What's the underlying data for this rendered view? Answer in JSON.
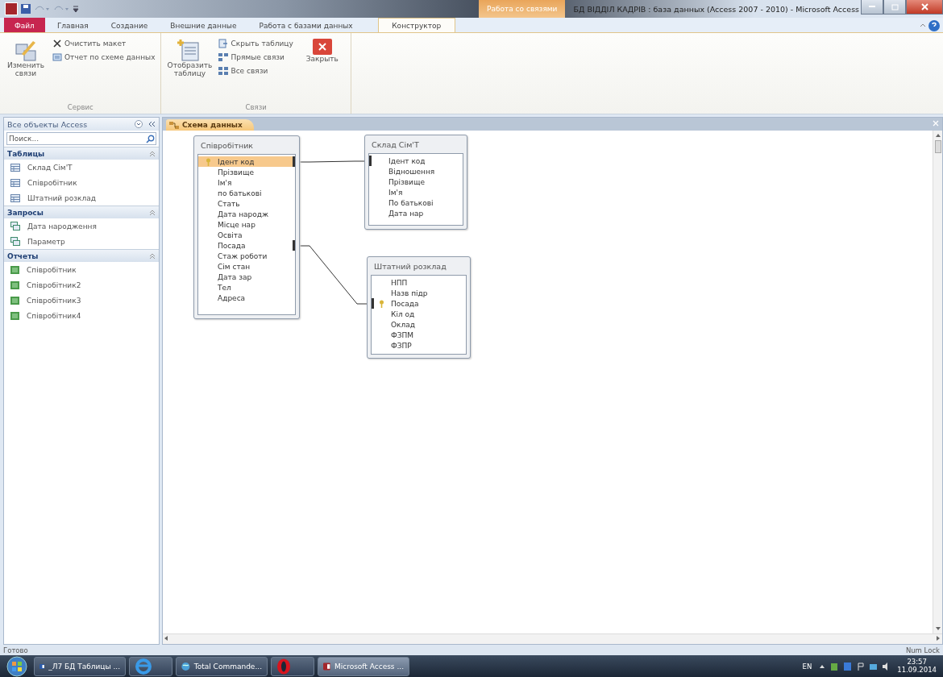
{
  "title_bar": {
    "context_group": "Работа со связями",
    "title": "БД ВІДДІЛ КАДРІВ : база данных (Access 2007 - 2010)  -  Microsoft Access"
  },
  "ribbon_tabs": [
    {
      "label": "Файл",
      "kind": "file",
      "selected": false
    },
    {
      "label": "Главная",
      "kind": "normal",
      "selected": false
    },
    {
      "label": "Создание",
      "kind": "normal",
      "selected": false
    },
    {
      "label": "Внешние данные",
      "kind": "normal",
      "selected": false
    },
    {
      "label": "Работа с базами данных",
      "kind": "normal",
      "selected": false
    },
    {
      "label": "Конструктор",
      "kind": "context",
      "selected": true
    }
  ],
  "ribbon_groups": [
    {
      "label": "Сервис",
      "buttons": [
        {
          "label": "Изменить связи",
          "kind": "large"
        },
        {
          "label": "Очистить макет",
          "kind": "small"
        },
        {
          "label": "Отчет по схеме данных",
          "kind": "small"
        }
      ]
    },
    {
      "label": "Связи",
      "buttons": [
        {
          "label": "Отобразить таблицу",
          "kind": "large"
        },
        {
          "label": "Скрыть таблицу",
          "kind": "small"
        },
        {
          "label": "Прямые связи",
          "kind": "small"
        },
        {
          "label": "Все связи",
          "kind": "small"
        },
        {
          "label": "Закрыть",
          "kind": "large"
        }
      ]
    }
  ],
  "nav_pane": {
    "title": "Все объекты Access",
    "search": {
      "placeholder": "Поиск..."
    },
    "sections": [
      {
        "title": "Таблицы",
        "items": [
          {
            "label": "Склад Сім'Т",
            "kind": "table"
          },
          {
            "label": "Співробітник",
            "kind": "table"
          },
          {
            "label": "Штатний розклад",
            "kind": "table"
          }
        ]
      },
      {
        "title": "Запросы",
        "items": [
          {
            "label": "Дата народження",
            "kind": "query"
          },
          {
            "label": "Параметр",
            "kind": "query"
          }
        ]
      },
      {
        "title": "Отчеты",
        "items": [
          {
            "label": "Співробітник",
            "kind": "report"
          },
          {
            "label": "Співробітник2",
            "kind": "report"
          },
          {
            "label": "Співробітник3",
            "kind": "report"
          },
          {
            "label": "Співробітник4",
            "kind": "report"
          }
        ]
      }
    ]
  },
  "document_tabs": [
    {
      "label": "Схема данных",
      "selected": true
    }
  ],
  "diagram": {
    "tables": [
      {
        "title": "Співробітник",
        "fields": [
          {
            "name": "Ідент код",
            "primary_key": true,
            "selected": true,
            "linked": true
          },
          {
            "name": "Прізвище",
            "primary_key": false,
            "selected": false,
            "linked": false
          },
          {
            "name": "Ім'я",
            "primary_key": false,
            "selected": false,
            "linked": false
          },
          {
            "name": "по батькові",
            "primary_key": false,
            "selected": false,
            "linked": false
          },
          {
            "name": "Стать",
            "primary_key": false,
            "selected": false,
            "linked": false
          },
          {
            "name": "Дата народж",
            "primary_key": false,
            "selected": false,
            "linked": false
          },
          {
            "name": "Місце нар",
            "primary_key": false,
            "selected": false,
            "linked": false
          },
          {
            "name": "Освіта",
            "primary_key": false,
            "selected": false,
            "linked": false
          },
          {
            "name": "Посада",
            "primary_key": false,
            "selected": false,
            "linked": true
          },
          {
            "name": "Стаж роботи",
            "primary_key": false,
            "selected": false,
            "linked": false
          },
          {
            "name": "Сім стан",
            "primary_key": false,
            "selected": false,
            "linked": false
          },
          {
            "name": "Дата зар",
            "primary_key": false,
            "selected": false,
            "linked": false
          },
          {
            "name": "Тел",
            "primary_key": false,
            "selected": false,
            "linked": false
          },
          {
            "name": "Адреса",
            "primary_key": false,
            "selected": false,
            "linked": false
          }
        ]
      },
      {
        "title": "Склад Сім'Т",
        "fields": [
          {
            "name": "Ідент код",
            "primary_key": false,
            "selected": false,
            "linked": true
          },
          {
            "name": "Відношення",
            "primary_key": false,
            "selected": false,
            "linked": false
          },
          {
            "name": "Прізвище",
            "primary_key": false,
            "selected": false,
            "linked": false
          },
          {
            "name": "Ім'я",
            "primary_key": false,
            "selected": false,
            "linked": false
          },
          {
            "name": "По батькові",
            "primary_key": false,
            "selected": false,
            "linked": false
          },
          {
            "name": "Дата нар",
            "primary_key": false,
            "selected": false,
            "linked": false
          }
        ]
      },
      {
        "title": "Штатний розклад",
        "fields": [
          {
            "name": "НПП",
            "primary_key": false,
            "selected": false,
            "linked": false
          },
          {
            "name": "Назв підр",
            "primary_key": false,
            "selected": false,
            "linked": false
          },
          {
            "name": "Посада",
            "primary_key": true,
            "selected": false,
            "linked": true
          },
          {
            "name": "Кіл од",
            "primary_key": false,
            "selected": false,
            "linked": false
          },
          {
            "name": "Оклад",
            "primary_key": false,
            "selected": false,
            "linked": false
          },
          {
            "name": "ФЗПМ",
            "primary_key": false,
            "selected": false,
            "linked": false
          },
          {
            "name": "ФЗПР",
            "primary_key": false,
            "selected": false,
            "linked": false
          }
        ]
      }
    ]
  },
  "status_bar": {
    "status": "Готово",
    "indicator": "Num Lock"
  },
  "taskbar": {
    "items": [
      {
        "label": "_Л7 БД Таблицы ...",
        "kind": "word",
        "selected": false
      },
      {
        "kind": "ie",
        "selected": false
      },
      {
        "label": "Total Commande...",
        "kind": "commander",
        "selected": false
      },
      {
        "kind": "opera",
        "selected": false
      },
      {
        "label": "Microsoft Access ...",
        "kind": "access",
        "selected": true
      }
    ],
    "language": "EN",
    "time": "23:57",
    "date": "11.09.2014"
  }
}
